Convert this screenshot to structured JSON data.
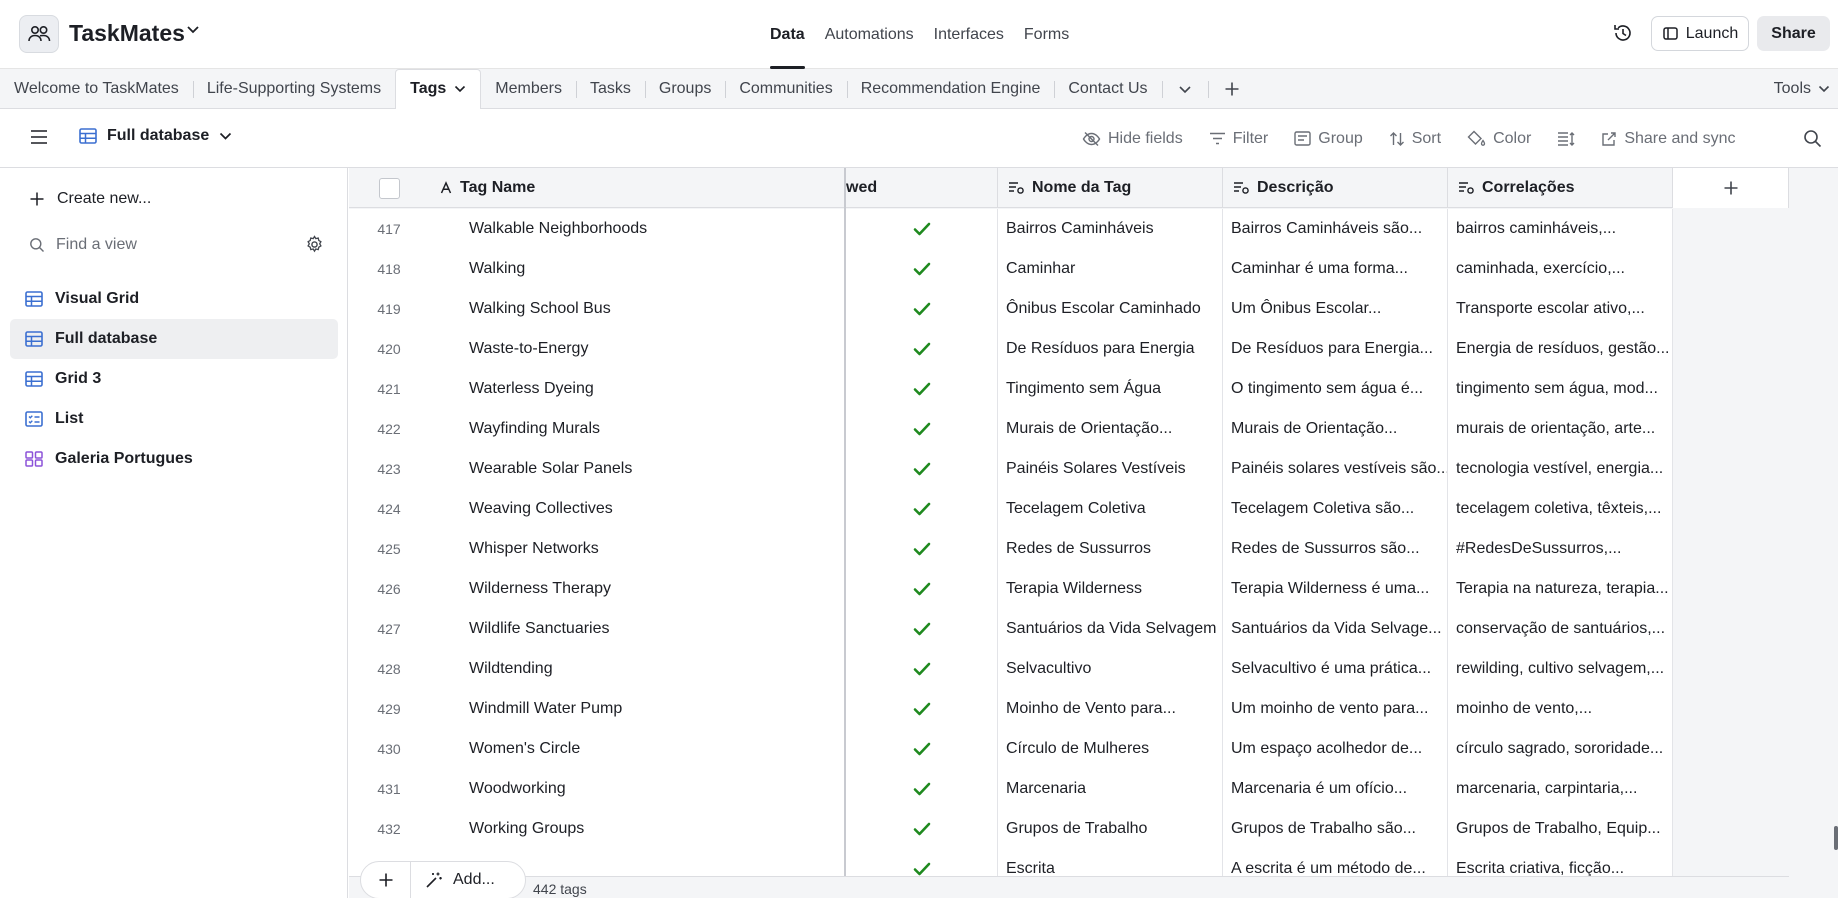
{
  "app": {
    "name": "TaskMates"
  },
  "top_nav": [
    "Data",
    "Automations",
    "Interfaces",
    "Forms"
  ],
  "top_actions": {
    "launch": "Launch",
    "share": "Share"
  },
  "tabs": [
    "Welcome to TaskMates",
    "Life-Supporting Systems",
    "Tags",
    "Members",
    "Tasks",
    "Groups",
    "Communities",
    "Recommendation Engine",
    "Contact Us"
  ],
  "active_tab": "Tags",
  "tools_label": "Tools",
  "view_title": "Full database",
  "toolbar": [
    "Hide fields",
    "Filter",
    "Group",
    "Sort",
    "Color",
    "Share and sync"
  ],
  "sidebar": {
    "create_new": "Create new...",
    "find_placeholder": "Find a view",
    "views": [
      "Visual Grid",
      "Full database",
      "Grid 3",
      "List",
      "Galeria Portugues"
    ]
  },
  "columns": [
    "Tag Name",
    "wed",
    "Nome da Tag",
    "Descrição",
    "Correlações"
  ],
  "rows": [
    {
      "n": "417",
      "name": "Walkable Neighborhoods",
      "pt": "Bairros Caminháveis",
      "desc": "Bairros Caminháveis são...",
      "corr": "bairros caminháveis,..."
    },
    {
      "n": "418",
      "name": "Walking",
      "pt": "Caminhar",
      "desc": "Caminhar é uma forma...",
      "corr": "caminhada, exercício,..."
    },
    {
      "n": "419",
      "name": "Walking School Bus",
      "pt": "Ônibus Escolar Caminhado",
      "desc": "Um Ônibus Escolar...",
      "corr": "Transporte escolar ativo,..."
    },
    {
      "n": "420",
      "name": "Waste-to-Energy",
      "pt": "De Resíduos para Energia",
      "desc": "De Resíduos para Energia...",
      "corr": "Energia de resíduos, gestão..."
    },
    {
      "n": "421",
      "name": "Waterless Dyeing",
      "pt": "Tingimento sem Água",
      "desc": "O tingimento sem água é...",
      "corr": "tingimento sem água, mod..."
    },
    {
      "n": "422",
      "name": "Wayfinding Murals",
      "pt": "Murais de Orientação...",
      "desc": "Murais de Orientação...",
      "corr": "murais de orientação, arte..."
    },
    {
      "n": "423",
      "name": "Wearable Solar Panels",
      "pt": "Painéis Solares Vestíveis",
      "desc": "Painéis solares vestíveis são...",
      "corr": "tecnologia vestível, energia..."
    },
    {
      "n": "424",
      "name": "Weaving Collectives",
      "pt": "Tecelagem Coletiva",
      "desc": "Tecelagem Coletiva são...",
      "corr": "tecelagem coletiva, têxteis,..."
    },
    {
      "n": "425",
      "name": "Whisper Networks",
      "pt": "Redes de Sussurros",
      "desc": "Redes de Sussurros são...",
      "corr": "#RedesDeSussurros,..."
    },
    {
      "n": "426",
      "name": "Wilderness Therapy",
      "pt": "Terapia Wilderness",
      "desc": "Terapia Wilderness é uma...",
      "corr": "Terapia na natureza, terapia..."
    },
    {
      "n": "427",
      "name": "Wildlife Sanctuaries",
      "pt": "Santuários da Vida Selvagem",
      "desc": "Santuários da Vida Selvage...",
      "corr": "conservação de santuários,..."
    },
    {
      "n": "428",
      "name": "Wildtending",
      "pt": "Selvacultivo",
      "desc": "Selvacultivo é uma prática...",
      "corr": "rewilding, cultivo selvagem,..."
    },
    {
      "n": "429",
      "name": "Windmill Water Pump",
      "pt": "Moinho de Vento para...",
      "desc": "Um moinho de vento para...",
      "corr": "moinho de vento,..."
    },
    {
      "n": "430",
      "name": "Women's Circle",
      "pt": "Círculo de Mulheres",
      "desc": "Um espaço acolhedor de...",
      "corr": "círculo sagrado, sororidade..."
    },
    {
      "n": "431",
      "name": "Woodworking",
      "pt": "Marcenaria",
      "desc": "Marcenaria é um ofício...",
      "corr": "marcenaria, carpintaria,..."
    },
    {
      "n": "432",
      "name": "Working Groups",
      "pt": "Grupos de Trabalho",
      "desc": "Grupos de Trabalho são...",
      "corr": "Grupos de Trabalho, Equip..."
    },
    {
      "n": "",
      "name": "",
      "pt": "Escrita",
      "desc": "A escrita é um método de...",
      "corr": "Escrita criativa, ficção..."
    }
  ],
  "footer": {
    "add_label": "Add...",
    "count": "442 tags"
  },
  "colors": {
    "check": "#1f8a1f",
    "accent": "#2d7ff9",
    "view_icon_blue": "#3b6fd1",
    "view_icon_purple": "#8c52d9"
  }
}
